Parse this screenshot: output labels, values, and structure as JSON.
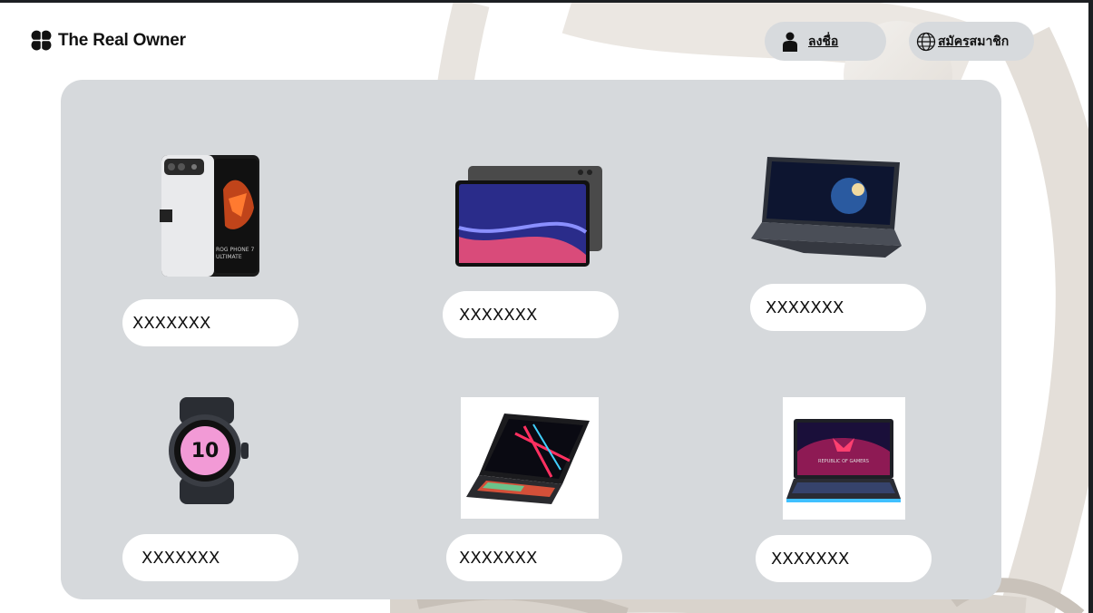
{
  "brand": {
    "name": "The Real Owner",
    "logo_icon": "flower-logo-icon"
  },
  "nav": {
    "login": {
      "label": "ลงชื่อ",
      "icon": "user-icon"
    },
    "register": {
      "label_underlined": "สมัคร",
      "label_rest": "สมาชิก",
      "icon": "globe-icon"
    }
  },
  "products": [
    {
      "name": "XXXXXXX",
      "image": "rog-phone-icon"
    },
    {
      "name": "XXXXXXX",
      "image": "tablet-icon"
    },
    {
      "name": "XXXXXXX",
      "image": "laptop-icon"
    },
    {
      "name": "XXXXXXX",
      "image": "smartwatch-icon"
    },
    {
      "name": "XXXXXXX",
      "image": "gaming-laptop-icon"
    },
    {
      "name": "XXXXXXX",
      "image": "gaming-laptop-icon"
    }
  ],
  "colors": {
    "panel": "#d6d9dc",
    "pill": "#ffffff",
    "nav_button": "#d7dadd"
  }
}
